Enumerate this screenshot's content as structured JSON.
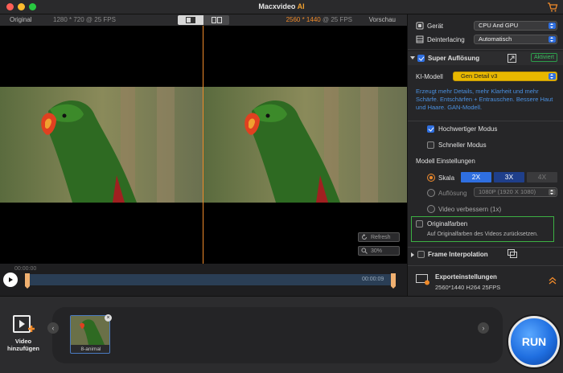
{
  "window": {
    "title_main": "Macxvideo",
    "title_ai": "AI"
  },
  "preview": {
    "left_label": "Original",
    "left_resolution": "1280 * 720 @ 25 FPS",
    "right_resolution_hl": "2560 * 1440",
    "right_resolution_rest": "@ 25 FPS",
    "right_label": "Vorschau",
    "refresh_label": "Refresh",
    "zoom_label": "30%"
  },
  "timeline": {
    "time_start": "00:00:00",
    "time_end": "00:00:09"
  },
  "panel": {
    "device_label": "Gerät",
    "device_value": "CPU And GPU",
    "deinterlacing_label": "Deinterlacing",
    "deinterlacing_value": "Automatisch",
    "super_title": "Super Auflösung",
    "active_badge": "Aktiviert",
    "ki_label": "KI-Modell",
    "ki_value": "Gen Detail v3",
    "ki_description": "Erzeugt mehr Details, mehr Klarheit und mehr Schärfe. Entschärfen + Entrauschen. Bessere Haut und Haare. GAN-Modell.",
    "high_quality_label": "Hochwertiger Modus",
    "fast_mode_label": "Schneller Modus",
    "model_settings_label": "Modell Einstellungen",
    "scale_label": "Skala",
    "scale_2x": "2X",
    "scale_3x": "3X",
    "scale_4x": "4X",
    "resolution_label": "Auflösung",
    "resolution_value": "1080P (1920 X 1080)",
    "video_improve_label": "Video verbessern (1x)",
    "original_colors_label": "Originalfarben",
    "original_colors_desc": "Auf Originalfarben des Videos zurücksetzen.",
    "frame_interp_label": "Frame Interpolation",
    "export_title": "Exporteinstellungen",
    "export_details": "2560*1440  H264  25FPS"
  },
  "bottom": {
    "add_video_line1": "Video",
    "add_video_line2": "hinzufügen",
    "thumb_label": "8-animal",
    "run_label": "RUN"
  },
  "colors": {
    "accent": "#f08a2a",
    "primary_blue": "#2f6fe0",
    "active_green": "#3cb043",
    "ki_yellow": "#e8b800"
  },
  "icons": [
    "cart-icon",
    "play-icon",
    "refresh-icon",
    "zoom-icon",
    "compare-icon",
    "expand-icon",
    "frame-icon",
    "export-icon",
    "chevron-up-icon",
    "film-add-icon",
    "chevron-left-icon",
    "chevron-right-icon",
    "close-icon"
  ]
}
